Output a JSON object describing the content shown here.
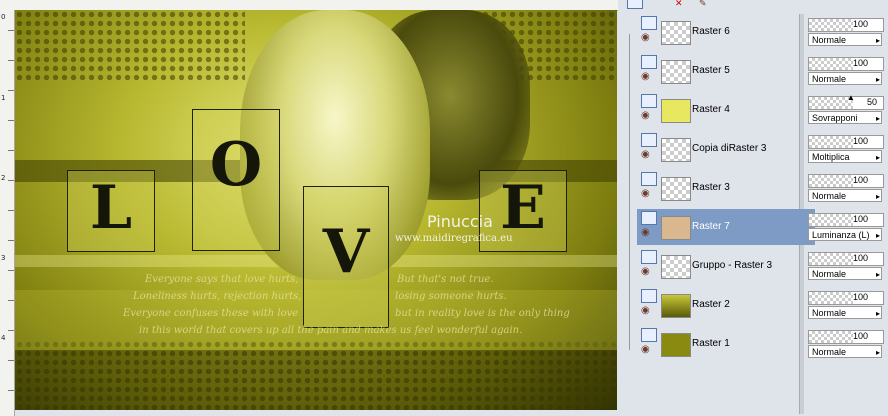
{
  "canvas": {
    "credit_name": "Pinuccia",
    "credit_url": "www.maidiregrafica.eu",
    "letters": [
      "L",
      "O",
      "V",
      "E"
    ],
    "poem_left": [
      "Everyone says that love hurts,",
      "Loneliness hurts, rejection hurts,",
      "Everyone confuses these with love"
    ],
    "poem_right": [
      "But that's not true.",
      "losing someone hurts.",
      "but in reality love is the only thing"
    ],
    "poem_bottom": "in this world that covers up all the pain and makes us feel wonderful again."
  },
  "ruler": {
    "numbers": [
      "0",
      "1",
      "2",
      "3",
      "4"
    ]
  },
  "layers": [
    {
      "name": "Raster 6",
      "opacity": "100",
      "blend": "Normale",
      "selected": false
    },
    {
      "name": "Raster 5",
      "opacity": "100",
      "blend": "Normale",
      "selected": false
    },
    {
      "name": "Raster 4",
      "opacity": "50",
      "blend": "Sovrapponi",
      "selected": false
    },
    {
      "name": "Copia diRaster 3",
      "opacity": "100",
      "blend": "Moltiplica",
      "selected": false
    },
    {
      "name": "Raster 3",
      "opacity": "100",
      "blend": "Normale",
      "selected": false
    },
    {
      "name": "Raster 7",
      "opacity": "100",
      "blend": "Luminanza (L)",
      "selected": true
    },
    {
      "name": "Gruppo - Raster 3",
      "opacity": "100",
      "blend": "Normale",
      "selected": false
    },
    {
      "name": "Raster 2",
      "opacity": "100",
      "blend": "Normale",
      "selected": false
    },
    {
      "name": "Raster 1",
      "opacity": "100",
      "blend": "Normale",
      "selected": false
    }
  ],
  "icons": {
    "visibility": "eye-icon",
    "layer_type": "raster-layer-icon",
    "delete": "delete-icon",
    "group": "group-icon"
  },
  "colors": {
    "selected_row": "#7d9bc4",
    "canvas_accent": "#c8c83a"
  }
}
